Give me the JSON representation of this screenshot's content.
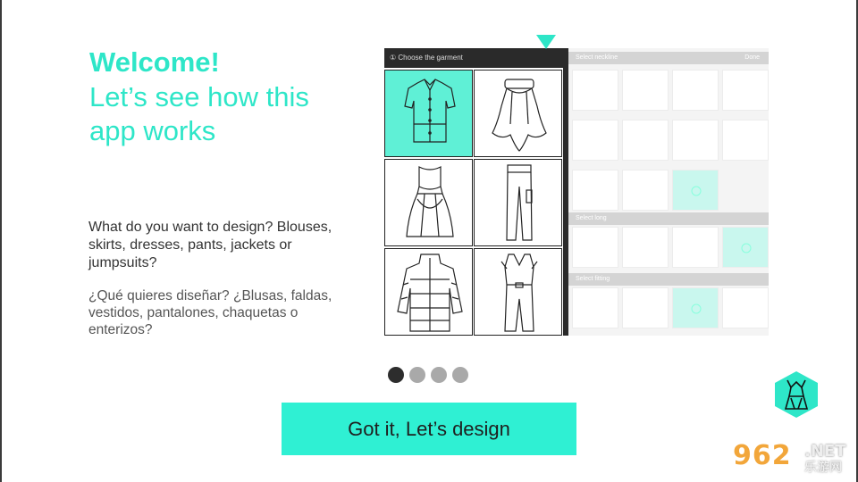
{
  "intro": {
    "welcome": "Welcome!",
    "subtitle": "Let’s see how this app works",
    "description_en": "What do you want to design? Blouses, skirts, dresses, pants, jackets or jumpsuits?",
    "description_es": "¿Qué quieres diseñar? ¿Blusas, faldas, vestidos, pantalones, chaquetas o enterizos?"
  },
  "mockup": {
    "left_header": "① Choose the garment",
    "garments": [
      "blouse-icon",
      "skirt-icon",
      "dress-icon",
      "pants-icon",
      "jacket-icon",
      "jumpsuit-icon"
    ],
    "selected_garment": 0,
    "right_panel": {
      "neckline_header": "Select neckline",
      "done_label": "Done",
      "long_header": "Select long",
      "fitting_header": "Select fitting"
    }
  },
  "pagination": {
    "total": 4,
    "active": 0
  },
  "cta": {
    "label": "Got it, Let’s design"
  },
  "app_icon": "dress-form-icon",
  "watermark": {
    "number": "962",
    "net": ".NET",
    "chinese": "乐游网"
  },
  "colors": {
    "accent": "#2ee6c8",
    "button": "#2ff0d3",
    "selected_cell": "#5ff0d6",
    "dot_active": "#2d2d2d",
    "dot_inactive": "#a9a9a9",
    "header_dark": "#2a2a2a"
  }
}
